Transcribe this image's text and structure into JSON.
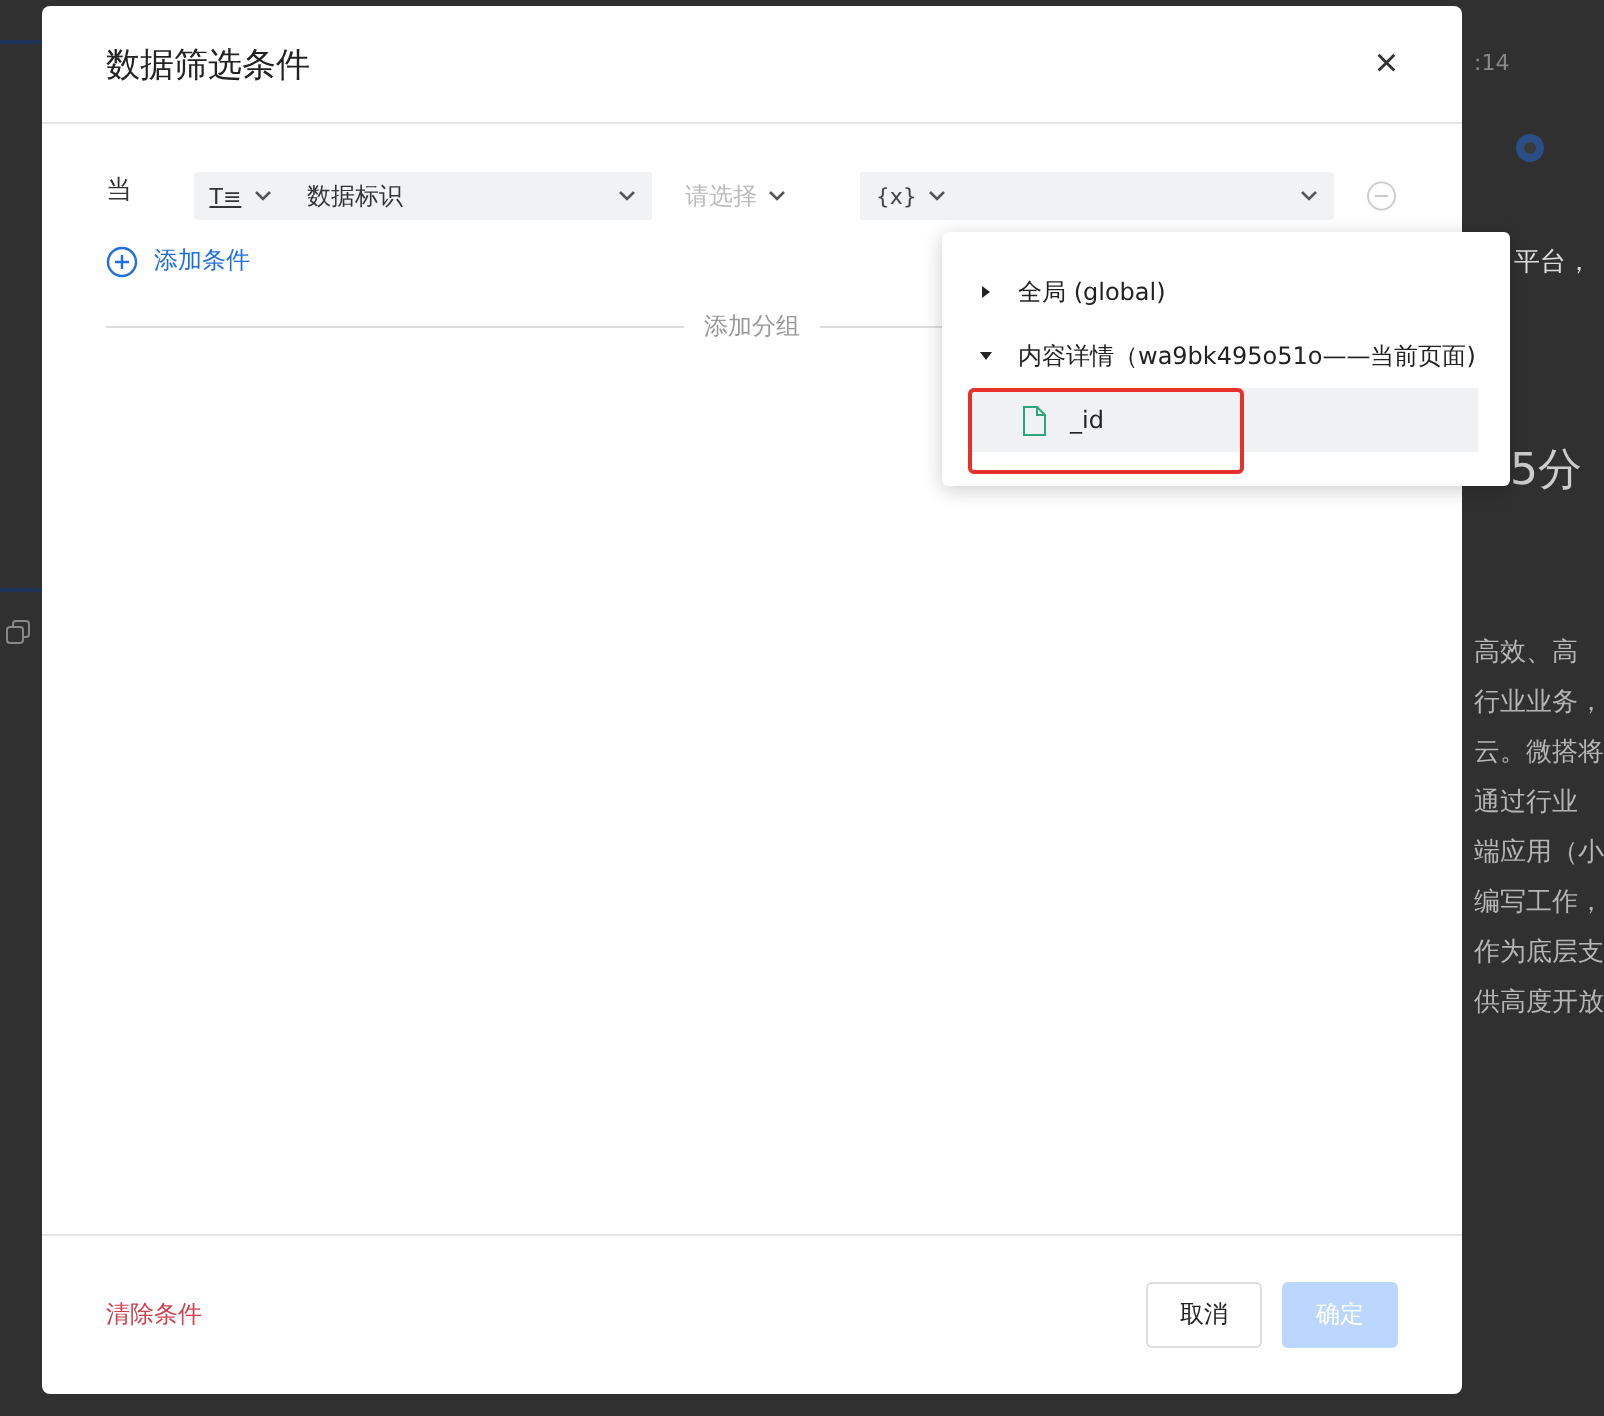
{
  "background": {
    "time": ":14",
    "lines": [
      {
        "text": "平台，",
        "kind": "small"
      },
      {
        "text": "5分",
        "kind": "large"
      },
      {
        "text": "高效、高",
        "kind": "para"
      },
      {
        "text": "行业业务，",
        "kind": "para"
      },
      {
        "text": "云。微搭将",
        "kind": "para"
      },
      {
        "text": "通过行业",
        "kind": "para"
      },
      {
        "text": "端应用（小",
        "kind": "para"
      },
      {
        "text": "编写工作，",
        "kind": "para"
      },
      {
        "text": "作为底层支",
        "kind": "para"
      },
      {
        "text": "供高度开放",
        "kind": "para"
      }
    ]
  },
  "dialog": {
    "title": "数据筛选条件",
    "close": "×",
    "condition": {
      "label": "当",
      "type_icon": "T≡",
      "field": "数据标识",
      "operator_placeholder": "请选择",
      "value_icon": "{x}"
    },
    "add_condition": "添加条件",
    "add_group": "添加分组",
    "menu": [
      {
        "label": "全局 (global)",
        "expanded": false
      },
      {
        "label": "内容详情（wa9bk495o51o——当前页面)",
        "expanded": true,
        "children": [
          {
            "label": "_id",
            "selected": true,
            "highlighted": true
          }
        ]
      }
    ],
    "footer": {
      "clear": "清除条件",
      "cancel": "取消",
      "confirm": {
        "label": "确定",
        "disabled": true
      }
    }
  }
}
